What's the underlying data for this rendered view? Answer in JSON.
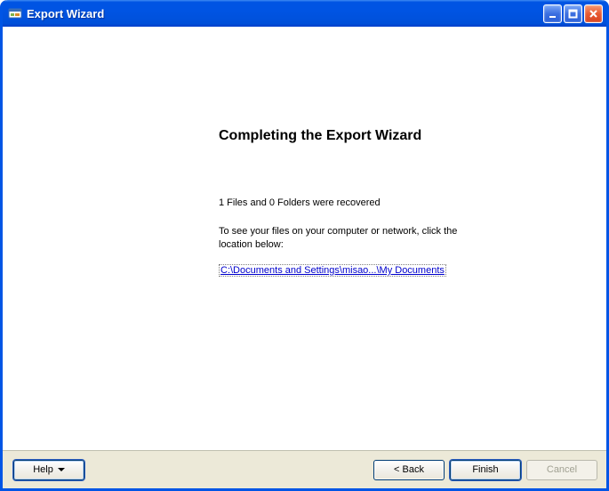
{
  "window": {
    "title": "Export Wizard"
  },
  "content": {
    "heading": "Completing the Export Wizard",
    "summary": "1 Files and 0 Folders were recovered",
    "instruction": "To see your files on your computer or network, click the location below:",
    "path_link": "C:\\Documents and Settings\\misao...\\My Documents"
  },
  "footer": {
    "help_label": "Help",
    "back_label": "< Back",
    "finish_label": "Finish",
    "cancel_label": "Cancel"
  }
}
